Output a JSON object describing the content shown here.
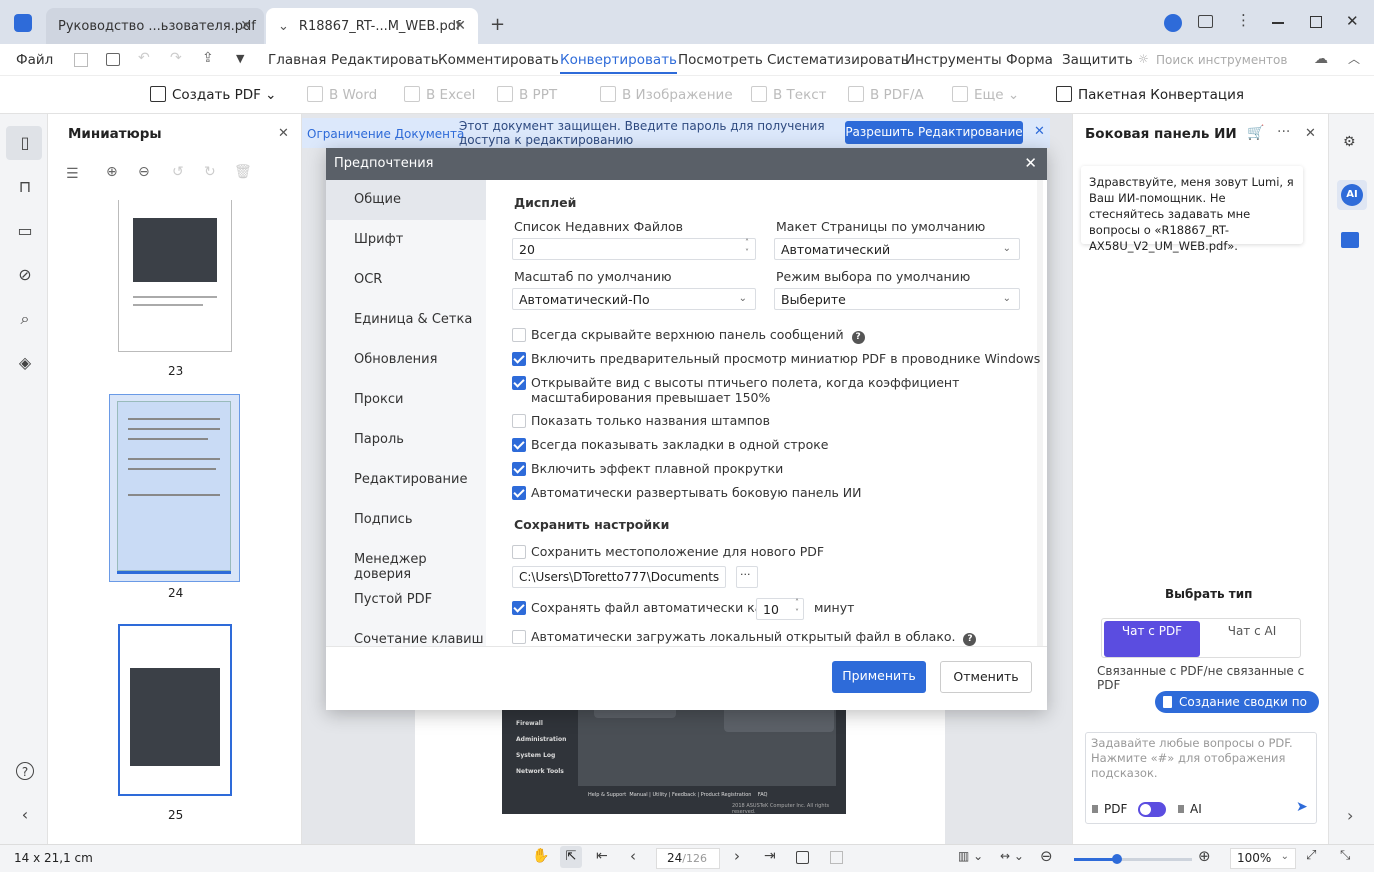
{
  "tabs": [
    {
      "label": "Руководство ...ьзователя.pdf"
    },
    {
      "label": "R18867_RT-...M_WEB.pdf"
    }
  ],
  "menu": {
    "file": "Файл",
    "items": [
      "Главная",
      "Редактировать",
      "Комментировать",
      "Конвертировать",
      "Посмотреть",
      "Систематизировать",
      "Инструменты",
      "Форма",
      "Защитить"
    ],
    "search_placeholder": "Поиск инструментов"
  },
  "toolbar": {
    "create_pdf": "Создать PDF",
    "word": "В Word",
    "excel": "В Excel",
    "ppt": "В PPT",
    "image": "В Изображение",
    "text": "В Текст",
    "pdfa": "В PDF/A",
    "more": "Еще",
    "batch": "Пакетная Конвертация"
  },
  "thumbnails": {
    "title": "Миниатюры",
    "pages": [
      "23",
      "24",
      "25"
    ]
  },
  "banner": {
    "restriction": "Ограничение Документа",
    "message": "Этот документ защищен. Введите пароль для получения доступа к редактированию",
    "button": "Разрешить Редактирование"
  },
  "dialog": {
    "title": "Предпочтения",
    "nav": [
      "Общие",
      "Шрифт",
      "OCR",
      "Единица & Сетка",
      "Обновления",
      "Прокси",
      "Пароль",
      "Редактирование",
      "Подпись",
      "Менеджер доверия",
      "Пустой PDF",
      "Сочетание клавиш"
    ],
    "display_section": "Дисплей",
    "recent_files_label": "Список Недавних Файлов",
    "recent_files_value": "20",
    "layout_label": "Макет Страницы по умолчанию",
    "layout_value": "Автоматический",
    "zoom_label": "Масштаб по умолчанию",
    "zoom_value": "Автоматический-По",
    "select_mode_label": "Режим выбора по умолчанию",
    "select_mode_value": "Выберите",
    "options": [
      {
        "label": "Всегда скрывайте верхнюю панель сообщений",
        "checked": false
      },
      {
        "label": "Включить предварительный просмотр миниатюр PDF в проводнике Windows",
        "checked": true
      },
      {
        "label": "Открывайте вид с высоты птичьего полета, когда коэффициент масштабирования превышает 150%",
        "checked": true
      },
      {
        "label": "Показать только названия штампов",
        "checked": false
      },
      {
        "label": "Всегда показывать закладки в одной строке",
        "checked": true
      },
      {
        "label": "Включить эффект плавной прокрутки",
        "checked": true
      },
      {
        "label": "Автоматически развертывать боковую панель ИИ",
        "checked": true
      }
    ],
    "save_section": "Сохранить настройки",
    "save_location_label": "Сохранить местоположение для нового PDF",
    "path": "C:\\Users\\DToretto777\\Documents",
    "browse": "···",
    "autosave_label": "Сохранять файл автоматически каждые",
    "autosave_value": "10",
    "autosave_unit": "минут",
    "cloud_label": "Автоматически загружать локальный открытый файл в облако.",
    "apply": "Применить",
    "cancel": "Отменить"
  },
  "ai": {
    "title": "Боковая панель ИИ",
    "greeting": "Здравствуйте, меня зовут Lumi, я Ваш ИИ-помощник. Не стесняйтесь задавать мне вопросы о «R18867_RT-AX58U_V2_UM_WEB.pdf».",
    "choose_type": "Выбрать тип",
    "chat_pdf": "Чат с PDF",
    "chat_ai": "Чат с AI",
    "related": "Связанные с PDF/не связанные с PDF",
    "summary_button": "Создание сводки по PDF",
    "input_placeholder": "Задавайте любые вопросы о PDF. Нажмите «#» для отображения подсказок.",
    "toggle_pdf": "PDF",
    "toggle_ai": "AI",
    "ai_badge": "AI"
  },
  "doc_menu": [
    "Firewall",
    "Administration",
    "System Log",
    "Network Tools"
  ],
  "doc_footer": "Help & Support  Manual | Utility | Feedback | Product Registration    FAQ",
  "doc_copyright": "2018 ASUSTeK Computer Inc. All rights reserved.",
  "status": {
    "size": "14 x 21,1 cm",
    "page_current": "24",
    "page_total": "/126",
    "zoom": "100%"
  },
  "colors": {
    "accent": "#2e6bd9",
    "chat_selected": "#5b4de0"
  }
}
